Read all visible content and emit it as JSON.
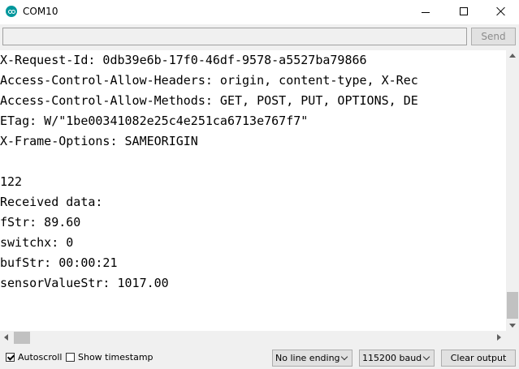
{
  "window": {
    "title": "COM10"
  },
  "send_bar": {
    "input_value": "",
    "send_label": "Send"
  },
  "console": {
    "lines": [
      "X-Request-Id: 0db39e6b-17f0-46df-9578-a5527ba79866",
      "Access-Control-Allow-Headers: origin, content-type, X-Rec",
      "Access-Control-Allow-Methods: GET, POST, PUT, OPTIONS, DE",
      "ETag: W/\"1be00341082e25c4e251ca6713e767f7\"",
      "X-Frame-Options: SAMEORIGIN",
      "",
      "122",
      "Received data:",
      "fStr: 89.60",
      "switchx: 0",
      "bufStr: 00:00:21",
      "sensorValueStr: 1017.00"
    ]
  },
  "footer": {
    "autoscroll": {
      "label": "Autoscroll",
      "checked": true
    },
    "timestamp": {
      "label": "Show timestamp",
      "checked": false
    },
    "line_ending": {
      "selected": "No line ending"
    },
    "baud": {
      "selected": "115200 baud"
    },
    "clear_label": "Clear output"
  },
  "colors": {
    "accent": "#00979c",
    "console_bg": "#ffffff",
    "chrome_bg": "#f0f0f0"
  }
}
